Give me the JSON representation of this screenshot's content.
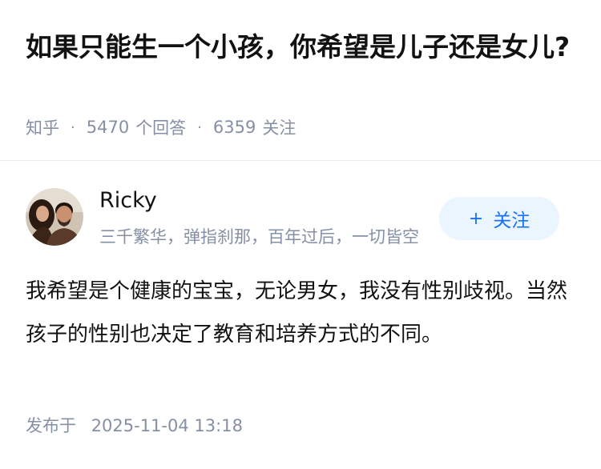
{
  "question": {
    "title": "如果只能生一个小孩，你希望是儿子还是女儿?",
    "source": "知乎",
    "answer_count": "5470",
    "answer_label": "个回答",
    "follower_count": "6359",
    "follower_label": "关注"
  },
  "author": {
    "name": "Ricky",
    "bio": "三千繁华，弹指刹那，百年过后，一切皆空",
    "avatar_icon": "user-avatar-photo"
  },
  "follow_button": {
    "icon": "plus-icon",
    "plus": "+",
    "label": "关注",
    "bg_color": "#ebf5ff",
    "text_color": "#1772f6"
  },
  "answer": {
    "content": "我希望是个健康的宝宝，无论男女，我没有性别歧视。当然孩子的性别也决定了教育和培养方式的不同。",
    "published_label": "发布于",
    "published_time": "2025-11-04 13:18"
  }
}
